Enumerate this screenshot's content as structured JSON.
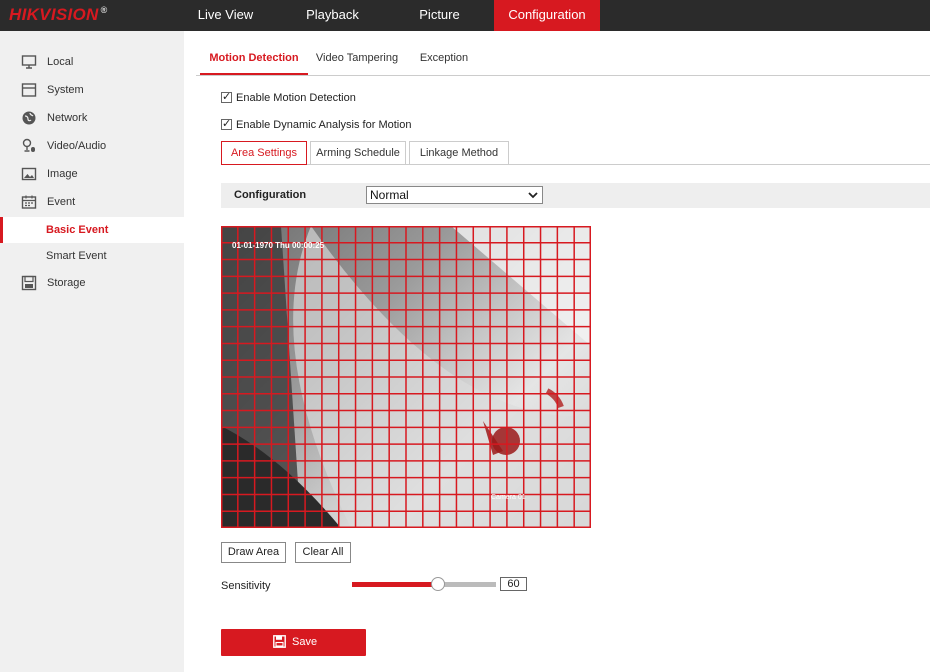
{
  "brand": {
    "logo": "HIKVISION",
    "mark": "®"
  },
  "top_nav": [
    {
      "label": "Live View"
    },
    {
      "label": "Playback"
    },
    {
      "label": "Picture"
    },
    {
      "label": "Configuration",
      "active": true
    }
  ],
  "sidebar": {
    "items": [
      {
        "label": "Local",
        "icon": "monitor-icon"
      },
      {
        "label": "System",
        "icon": "system-icon"
      },
      {
        "label": "Network",
        "icon": "globe-icon"
      },
      {
        "label": "Video/Audio",
        "icon": "camera-mic-icon"
      },
      {
        "label": "Image",
        "icon": "image-icon"
      },
      {
        "label": "Event",
        "icon": "calendar-icon"
      }
    ],
    "sub_items": [
      {
        "label": "Basic Event",
        "active": true
      },
      {
        "label": "Smart Event"
      }
    ],
    "storage": {
      "label": "Storage",
      "icon": "storage-icon"
    }
  },
  "tabs": [
    {
      "label": "Motion Detection",
      "active": true
    },
    {
      "label": "Video Tampering"
    },
    {
      "label": "Exception"
    }
  ],
  "checkboxes": {
    "enable_motion": {
      "label": "Enable Motion Detection",
      "checked": true
    },
    "enable_dynamic": {
      "label": "Enable Dynamic Analysis for Motion",
      "checked": true
    }
  },
  "steps": [
    {
      "label": "Area Settings",
      "active": true
    },
    {
      "label": "Arming Schedule"
    },
    {
      "label": "Linkage Method"
    }
  ],
  "configuration": {
    "label": "Configuration",
    "value": "Normal"
  },
  "video": {
    "osd_time": "01-01-1970 Thu 00:00:25",
    "osd_camera": "Camera 01",
    "grid_color": "#d71920"
  },
  "buttons": {
    "draw_area": "Draw Area",
    "clear_all": "Clear All",
    "save": "Save"
  },
  "sensitivity": {
    "label": "Sensitivity",
    "value": "60",
    "level_percent": 60
  },
  "colors": {
    "accent": "#d71920",
    "topbar": "#2b2b2b",
    "sidebar": "#f0f0f0"
  }
}
